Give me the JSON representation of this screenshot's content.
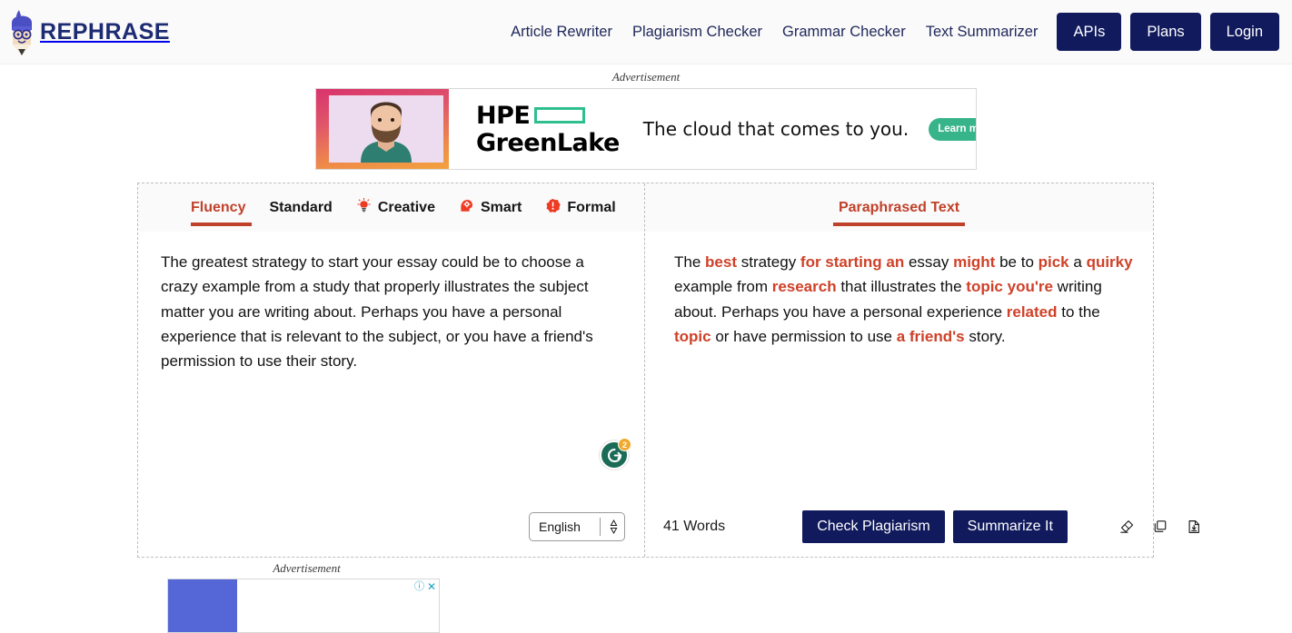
{
  "header": {
    "logo_text": "REPHRASE",
    "logo_icon": "pencil-character-icon",
    "nav_links": [
      {
        "label": "Article Rewriter"
      },
      {
        "label": "Plagiarism Checker"
      },
      {
        "label": "Grammar Checker"
      },
      {
        "label": "Text Summarizer"
      }
    ],
    "buttons": [
      {
        "label": "APIs"
      },
      {
        "label": "Plans"
      },
      {
        "label": "Login"
      }
    ],
    "brand_color": "#1d2b72",
    "button_color": "#101a5c"
  },
  "ad_top": {
    "label": "Advertisement",
    "brand_line1": "HPE",
    "brand_line2": "GreenLake",
    "tagline": "The cloud that comes to you.",
    "cta": "Learn more",
    "info_icon": "info-icon",
    "close_icon": "close-icon",
    "accent_color": "#38b48a"
  },
  "ad_bottom": {
    "label": "Advertisement",
    "info_icon": "info-icon",
    "close_icon": "close-icon"
  },
  "editor": {
    "tabs": [
      {
        "label": "Fluency",
        "icon": "",
        "active": true
      },
      {
        "label": "Standard",
        "icon": "",
        "active": false
      },
      {
        "label": "Creative",
        "icon": "lightbulb-icon",
        "active": false
      },
      {
        "label": "Smart",
        "icon": "brain-head-icon",
        "active": false
      },
      {
        "label": "Formal",
        "icon": "exclamation-circle-icon",
        "active": false
      }
    ],
    "active_color": "#c0412a",
    "input_text": "The greatest strategy to start your essay could be to choose a crazy example from a study that properly illustrates the subject matter you are writing about. Perhaps you have a personal experience that is relevant to the subject, or you have a friend's permission to use their story.",
    "grammarly": {
      "icon": "grammarly-icon",
      "badge_count": "2"
    },
    "language": {
      "value": "English",
      "icon": "updown-arrows-icon"
    },
    "output_tab_label": "Paraphrased Text",
    "output_segments": [
      {
        "text": "The ",
        "highlight": false
      },
      {
        "text": "best",
        "highlight": true
      },
      {
        "text": " strategy ",
        "highlight": false
      },
      {
        "text": "for starting an",
        "highlight": true
      },
      {
        "text": " essay ",
        "highlight": false
      },
      {
        "text": "might",
        "highlight": true
      },
      {
        "text": " be to ",
        "highlight": false
      },
      {
        "text": "pick",
        "highlight": true
      },
      {
        "text": " a ",
        "highlight": false
      },
      {
        "text": "quirky",
        "highlight": true
      },
      {
        "text": " example from ",
        "highlight": false
      },
      {
        "text": "research",
        "highlight": true
      },
      {
        "text": " that illustrates the ",
        "highlight": false
      },
      {
        "text": "topic you're",
        "highlight": true
      },
      {
        "text": " writing about. Perhaps you have a personal experience ",
        "highlight": false
      },
      {
        "text": "related",
        "highlight": true
      },
      {
        "text": " to the ",
        "highlight": false
      },
      {
        "text": "topic",
        "highlight": true
      },
      {
        "text": " or have permission to use ",
        "highlight": false
      },
      {
        "text": "a friend's",
        "highlight": true
      },
      {
        "text": " story.",
        "highlight": false
      }
    ],
    "word_count": "41 Words",
    "actions": [
      {
        "label": "Check Plagiarism"
      },
      {
        "label": "Summarize It"
      }
    ],
    "icon_buttons": [
      {
        "name": "eraser-icon"
      },
      {
        "name": "copy-icon"
      },
      {
        "name": "download-icon"
      }
    ]
  }
}
